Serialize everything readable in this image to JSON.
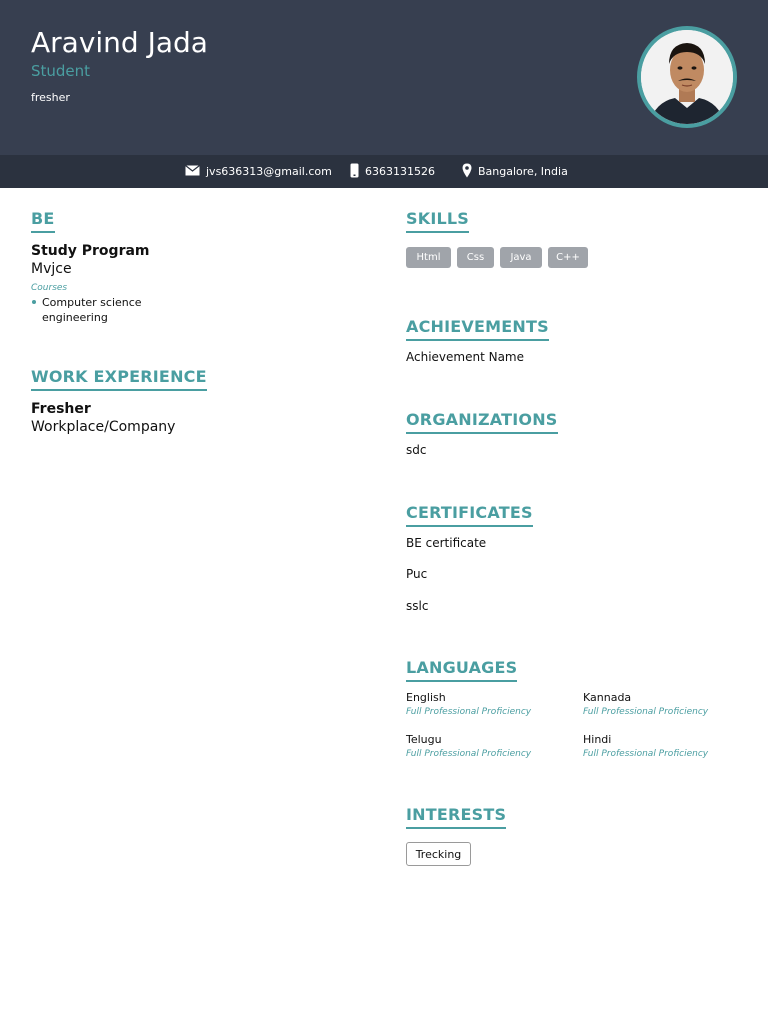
{
  "header": {
    "name": "Aravind Jada",
    "role": "Student",
    "summary": "fresher"
  },
  "contact": {
    "email": "jvs636313@gmail.com",
    "phone": "6363131526",
    "location": "Bangalore, India",
    "icons": [
      "envelope-icon",
      "phone-icon",
      "location-pin-icon"
    ]
  },
  "education": {
    "title": "BE",
    "program": "Study Program",
    "institution": "Mvjce",
    "courses_label": "Courses",
    "courses": [
      "Computer science engineering"
    ]
  },
  "work": {
    "title": "WORK EXPERIENCE",
    "position": "Fresher",
    "company": "Workplace/Company"
  },
  "skills": {
    "title": "SKILLS",
    "items": [
      "Html",
      "Css",
      "Java",
      "C++"
    ]
  },
  "achievements": {
    "title": "ACHIEVEMENTS",
    "items": [
      "Achievement Name"
    ]
  },
  "organizations": {
    "title": "ORGANIZATIONS",
    "items": [
      "sdc"
    ]
  },
  "certificates": {
    "title": "CERTIFICATES",
    "items": [
      "BE certificate",
      "Puc",
      "sslc"
    ]
  },
  "languages": {
    "title": "LANGUAGES",
    "items": [
      {
        "name": "English",
        "level": "Full Professional Proficiency"
      },
      {
        "name": "Kannada",
        "level": "Full Professional Proficiency"
      },
      {
        "name": "Telugu",
        "level": "Full Professional Proficiency"
      },
      {
        "name": "Hindi",
        "level": "Full Professional Proficiency"
      }
    ]
  },
  "interests": {
    "title": "INTERESTS",
    "items": [
      "Trecking"
    ]
  },
  "colors": {
    "header_bg": "#373f50",
    "contact_bg": "#2b323f",
    "accent": "#4a9ea1",
    "skill_bg": "#a0a4aa"
  }
}
